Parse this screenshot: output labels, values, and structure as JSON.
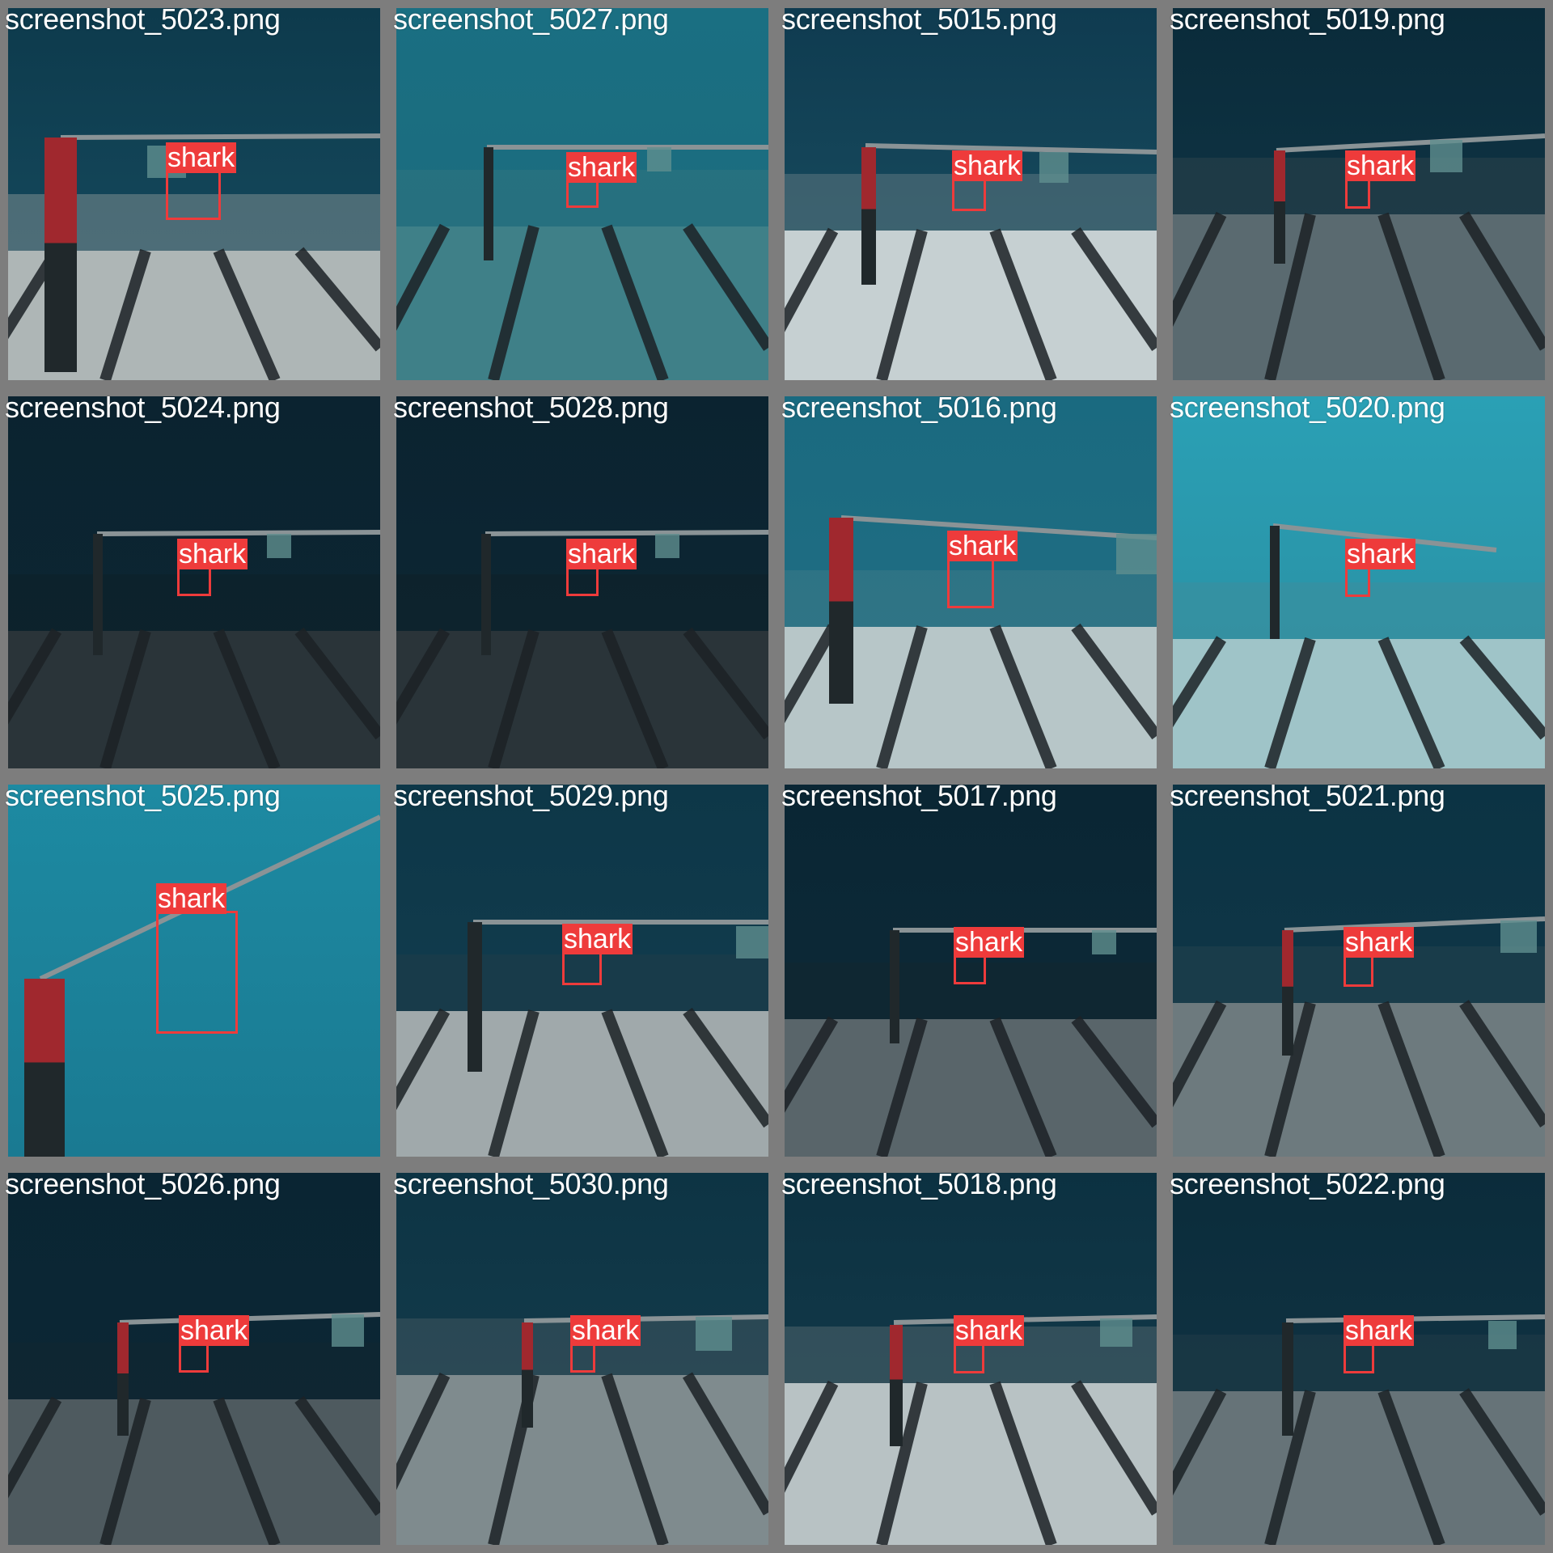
{
  "detection_label": "shark",
  "colors": {
    "box": "#ee3b3b",
    "border": "#8c8c8c",
    "text": "#ffffff"
  },
  "tiles": [
    {
      "filename": "screenshot_5023.png",
      "label": "shark"
    },
    {
      "filename": "screenshot_5027.png",
      "label": "shark"
    },
    {
      "filename": "screenshot_5015.png",
      "label": "shark"
    },
    {
      "filename": "screenshot_5019.png",
      "label": "shark"
    },
    {
      "filename": "screenshot_5024.png",
      "label": "shark"
    },
    {
      "filename": "screenshot_5028.png",
      "label": "shark"
    },
    {
      "filename": "screenshot_5016.png",
      "label": "shark"
    },
    {
      "filename": "screenshot_5020.png",
      "label": "shark"
    },
    {
      "filename": "screenshot_5025.png",
      "label": "shark"
    },
    {
      "filename": "screenshot_5029.png",
      "label": "shark"
    },
    {
      "filename": "screenshot_5017.png",
      "label": "shark"
    },
    {
      "filename": "screenshot_5021.png",
      "label": "shark"
    },
    {
      "filename": "screenshot_5026.png",
      "label": "shark"
    },
    {
      "filename": "screenshot_5030.png",
      "label": "shark"
    },
    {
      "filename": "screenshot_5018.png",
      "label": "shark"
    },
    {
      "filename": "screenshot_5022.png",
      "label": "shark"
    }
  ]
}
